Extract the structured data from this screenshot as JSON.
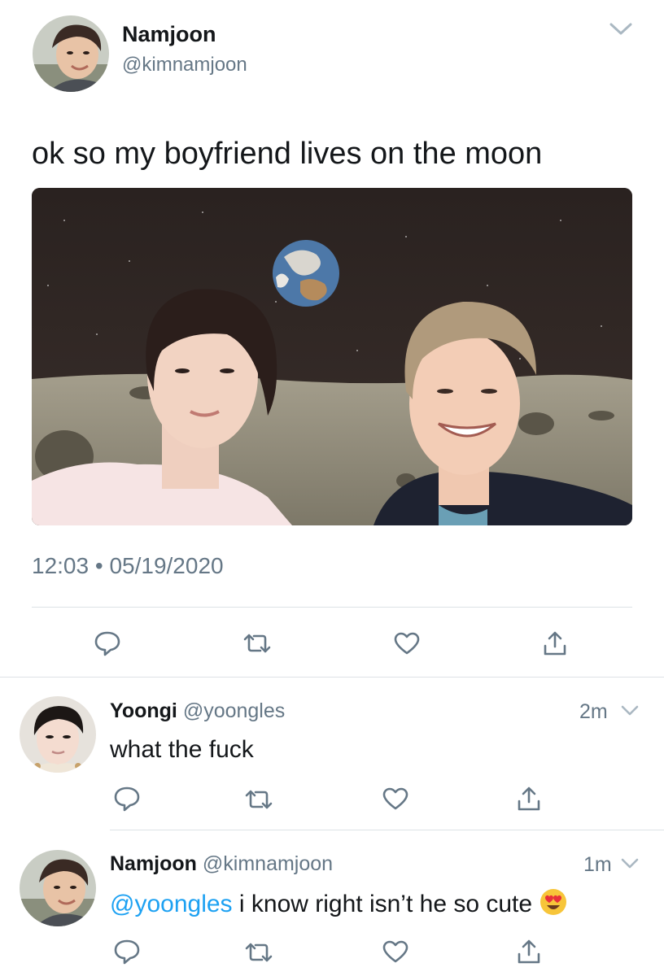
{
  "main_tweet": {
    "author_name": "Namjoon",
    "author_handle": "@kimnamjoon",
    "text": "ok so my boyfriend lives on the moon",
    "time": "12:03",
    "separator": "•",
    "date": "05/19/2020"
  },
  "replies": [
    {
      "author_name": "Yoongi",
      "author_handle": "@yoongles",
      "age": "2m",
      "text": "what the fuck"
    },
    {
      "author_name": "Namjoon",
      "author_handle": "@kimnamjoon",
      "age": "1m",
      "mention": "@yoongles",
      "text": " i know right isn’t he so cute",
      "emoji": "heart-eyes-emoji"
    }
  ],
  "icons": {
    "reply": "reply-icon",
    "retweet": "retweet-icon",
    "like": "heart-icon",
    "share": "share-icon",
    "menu": "chevron-down-icon"
  },
  "colors": {
    "text": "#14171a",
    "secondary": "#657786",
    "link": "#1da1f2",
    "divider": "#dde2e6"
  }
}
